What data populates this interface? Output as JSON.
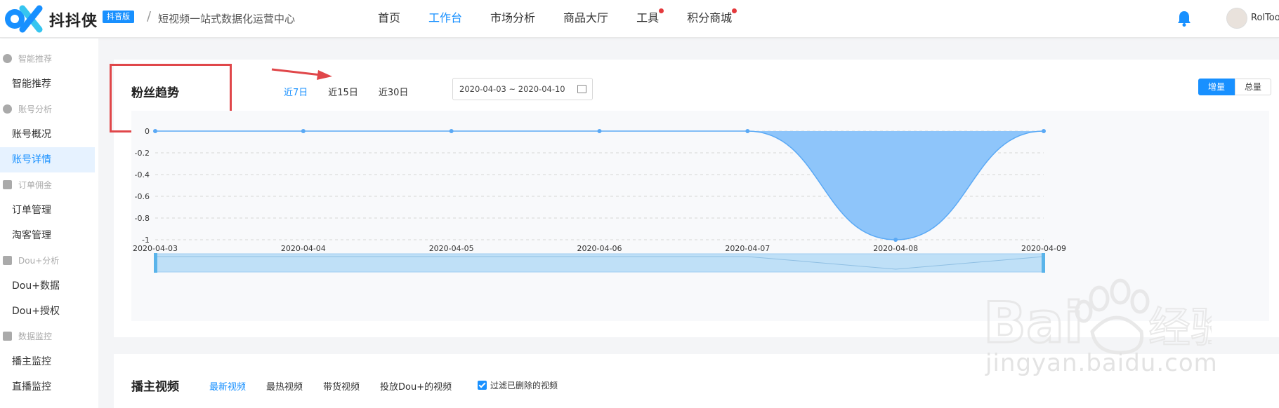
{
  "header": {
    "brand": "抖抖侠",
    "badge": "抖音版",
    "separator": "/",
    "subtitle": "短视频一站式数据化运营中心",
    "nav": [
      {
        "label": "首页",
        "active": false,
        "dot": false
      },
      {
        "label": "工作台",
        "active": true,
        "dot": false
      },
      {
        "label": "市场分析",
        "active": false,
        "dot": false
      },
      {
        "label": "商品大厅",
        "active": false,
        "dot": false
      },
      {
        "label": "工具",
        "active": false,
        "dot": true
      },
      {
        "label": "积分商城",
        "active": false,
        "dot": true
      }
    ],
    "username": "RolToo",
    "icons": {
      "bell": "bell-icon",
      "avatar": "avatar"
    }
  },
  "sidebar": {
    "groups": [
      {
        "label": "智能推荐",
        "icon": "pie-icon",
        "items": [
          "智能推荐"
        ]
      },
      {
        "label": "账号分析",
        "icon": "pie-chart-icon",
        "items": [
          "账号概况",
          "账号详情"
        ]
      },
      {
        "label": "订单佣金",
        "icon": "doc-icon",
        "items": [
          "订单管理",
          "淘客管理"
        ]
      },
      {
        "label": "Dou+分析",
        "icon": "doc-icon",
        "items": [
          "Dou+数据",
          "Dou+授权"
        ]
      },
      {
        "label": "数据监控",
        "icon": "doc-icon",
        "items": [
          "播主监控",
          "直播监控"
        ]
      }
    ],
    "active_item": "账号详情"
  },
  "fans_card": {
    "title": "粉丝趋势",
    "range_tabs": [
      {
        "label": "近7日",
        "active": true
      },
      {
        "label": "近15日",
        "active": false
      },
      {
        "label": "近30日",
        "active": false
      }
    ],
    "date_range": "2020-04-03 ~ 2020-04-10",
    "toggle": [
      {
        "label": "增量",
        "active": true
      },
      {
        "label": "总量",
        "active": false
      }
    ]
  },
  "chart_data": {
    "type": "area",
    "categories": [
      "2020-04-03",
      "2020-04-04",
      "2020-04-05",
      "2020-04-06",
      "2020-04-07",
      "2020-04-08",
      "2020-04-09"
    ],
    "series": [
      {
        "values": [
          0,
          0,
          0,
          0,
          0,
          -1,
          0
        ]
      }
    ],
    "yticks": [
      "0",
      "-0.2",
      "-0.4",
      "-0.6",
      "-0.8",
      "-1"
    ],
    "ylim": [
      -1,
      0
    ],
    "grid": true,
    "colors": {
      "line": "#5aa9f5",
      "fill": "#8ec5fa",
      "slider": "#bfe0f7"
    }
  },
  "video_card": {
    "title": "播主视频",
    "tabs": [
      {
        "label": "最新视频",
        "active": true
      },
      {
        "label": "最热视频",
        "active": false
      },
      {
        "label": "带货视频",
        "active": false
      },
      {
        "label": "投放Dou+的视频",
        "active": false
      }
    ],
    "filter_label": "过滤已删除的视频",
    "filter_checked": true
  },
  "watermark": {
    "logo": "Bai du 经验",
    "url": "jingyan.baidu.com"
  },
  "colors": {
    "accent": "#1890ff",
    "highlight_box": "#e0474a",
    "dot": "#e4393c"
  }
}
